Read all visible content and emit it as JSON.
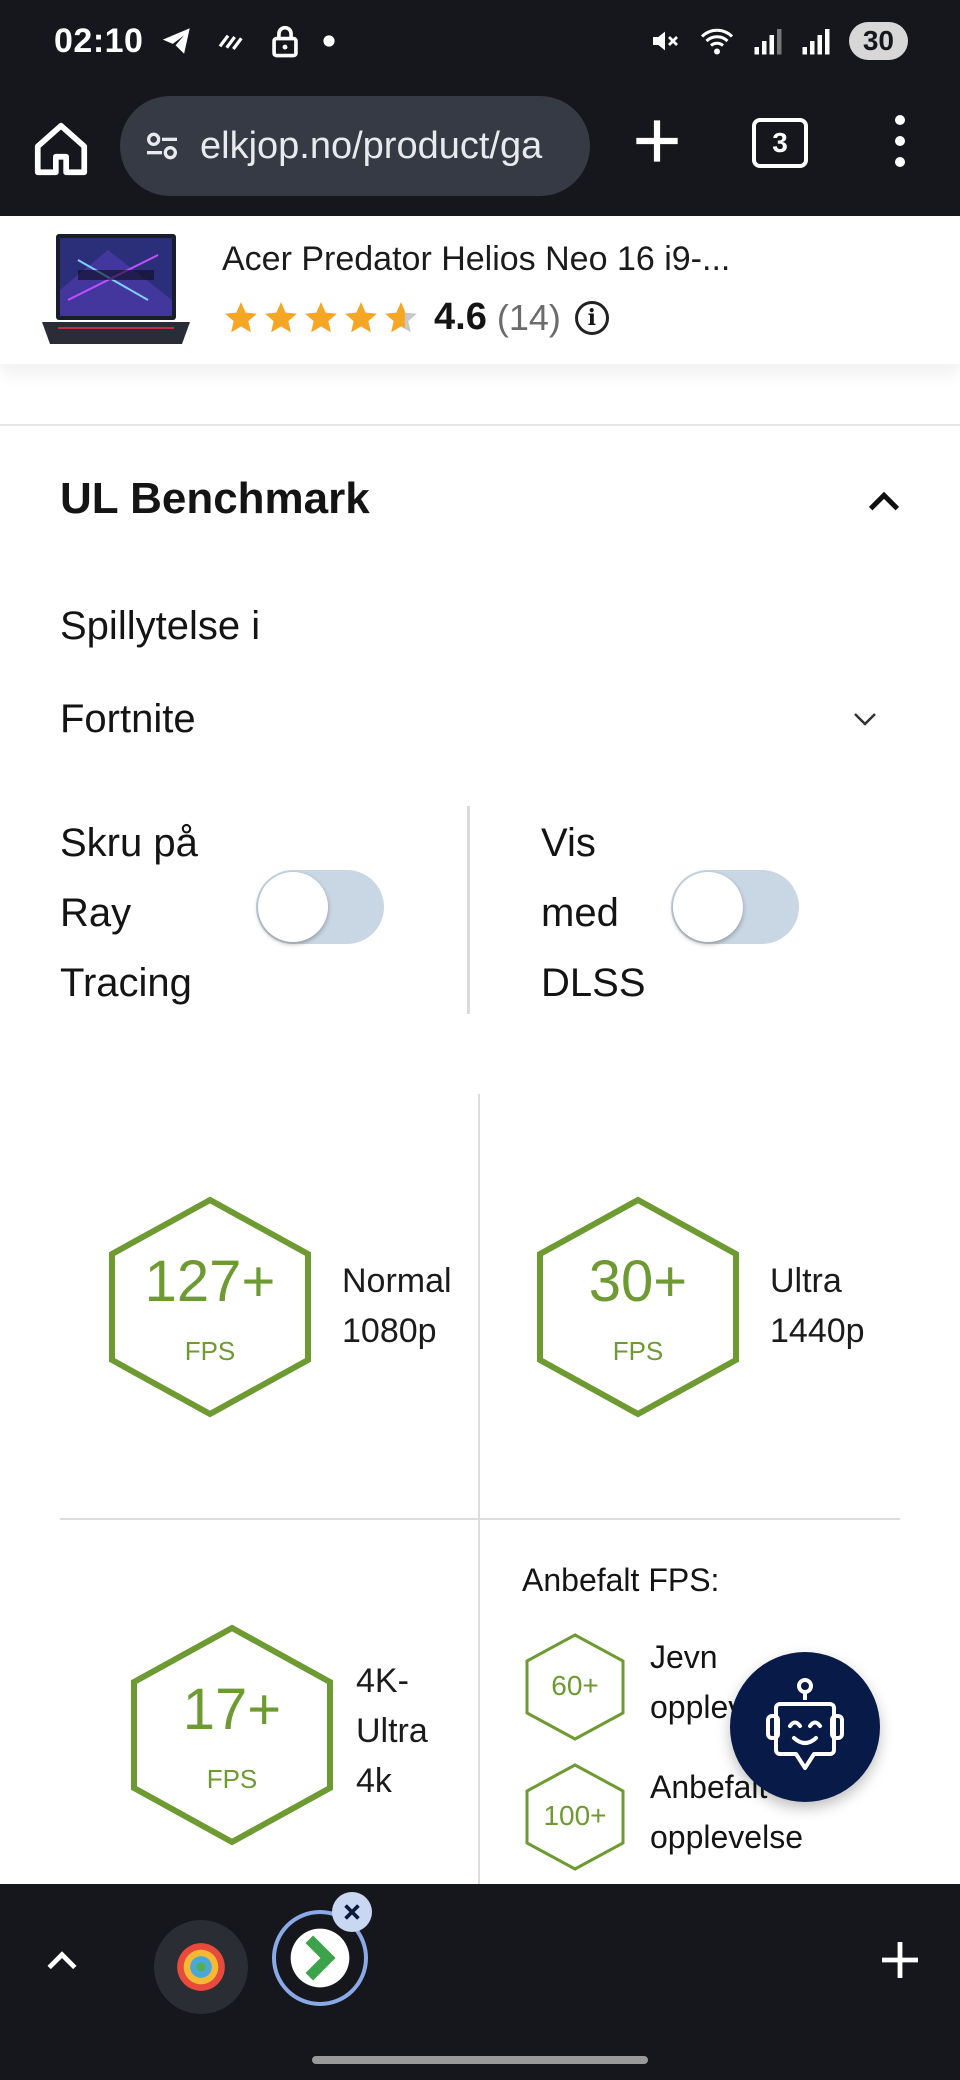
{
  "status_bar": {
    "time": "02:10",
    "battery": "30",
    "left_icons": [
      "telegram-icon",
      "data-stripes-icon",
      "lock-icon",
      "dot-icon"
    ],
    "right_icons": [
      "mute-icon",
      "wifi-icon",
      "signal-icon",
      "signal-r-icon"
    ]
  },
  "browser": {
    "url": "elkjop.no/product/ga",
    "tab_count": "3"
  },
  "product": {
    "name": "Acer Predator Helios Neo 16 i9-...",
    "rating_value": 4.6,
    "rating_display": "4.6",
    "review_count": "(14)",
    "star_color": "#f5a623"
  },
  "benchmark": {
    "title": "UL Benchmark",
    "game_label": "Spillytelse i",
    "selected_game": "Fortnite",
    "ray_tracing": {
      "lines": [
        "Skru på",
        "Ray",
        "Tracing"
      ],
      "enabled": false
    },
    "dlss": {
      "lines": [
        "Vis",
        "med",
        "DLSS"
      ],
      "enabled": false
    },
    "accent_color": "#6e9a32",
    "results": [
      {
        "value": "127+",
        "unit": "FPS",
        "quality": "Normal",
        "resolution": "1080p"
      },
      {
        "value": "30+",
        "unit": "FPS",
        "quality": "Ultra",
        "resolution": "1440p"
      },
      {
        "value": "17+",
        "unit": "FPS",
        "quality": "4K-",
        "resolution_lines": [
          "Ultra",
          "4k"
        ]
      }
    ],
    "recommended": {
      "title": "Anbefalt FPS:",
      "items": [
        {
          "value": "60+",
          "lines": [
            "Jevn",
            "opplevelse"
          ]
        },
        {
          "value": "100+",
          "lines": [
            "Anbefalt",
            "opplevelse"
          ]
        }
      ]
    }
  },
  "chat": {
    "icon": "robot-chat-icon",
    "color": "#071a48"
  },
  "bottom_bar": {
    "tab_groups": 2
  }
}
